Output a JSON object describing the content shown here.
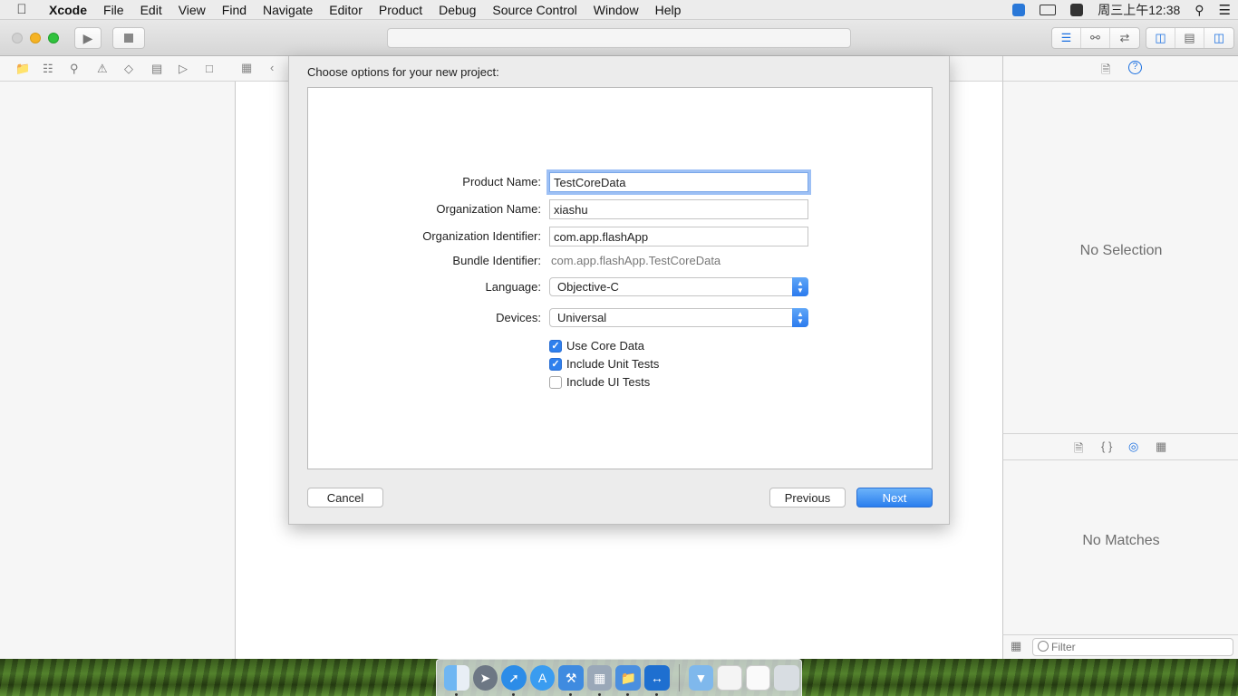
{
  "menubar": {
    "app_name": "Xcode",
    "items": [
      "File",
      "Edit",
      "View",
      "Find",
      "Navigate",
      "Editor",
      "Product",
      "Debug",
      "Source Control",
      "Window",
      "Help"
    ],
    "clock": "周三上午12:38"
  },
  "colors": {
    "accent": "#2f80ed",
    "traffic_close": "#d0d0d0",
    "traffic_minimize": "#f5b324",
    "traffic_zoom": "#30c23d"
  },
  "sheet": {
    "title": "Choose options for your new project:",
    "fields": {
      "product_name": {
        "label": "Product Name:",
        "value": "TestCoreData"
      },
      "organization_name": {
        "label": "Organization Name:",
        "value": "xiashu"
      },
      "organization_identifier": {
        "label": "Organization Identifier:",
        "value": "com.app.flashApp"
      },
      "bundle_identifier": {
        "label": "Bundle Identifier:",
        "value": "com.app.flashApp.TestCoreData"
      },
      "language": {
        "label": "Language:",
        "value": "Objective-C"
      },
      "devices": {
        "label": "Devices:",
        "value": "Universal"
      }
    },
    "checkboxes": [
      {
        "label": "Use Core Data",
        "checked": true
      },
      {
        "label": "Include Unit Tests",
        "checked": true
      },
      {
        "label": "Include UI Tests",
        "checked": false
      }
    ],
    "buttons": {
      "cancel": "Cancel",
      "previous": "Previous",
      "next": "Next"
    }
  },
  "utilities": {
    "inspector_empty": "No Selection",
    "library_empty": "No Matches",
    "filter_placeholder": "Filter"
  },
  "dock_items": [
    "finder-icon",
    "launchpad-icon",
    "safari-icon",
    "app-store-icon",
    "xcode-icon",
    "preview-icon",
    "folder-icon",
    "teamviewer-icon",
    "downloads-folder-icon",
    "screenshot-icon",
    "document-icon",
    "trash-icon"
  ]
}
